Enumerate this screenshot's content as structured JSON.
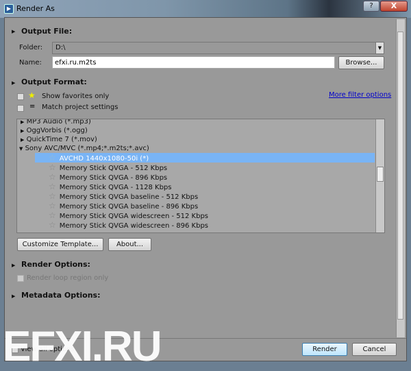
{
  "window": {
    "title": "Render As",
    "help": "?",
    "close": "X"
  },
  "output_file": {
    "header": "Output File:",
    "folder_label": "Folder:",
    "folder_value": "D:\\",
    "name_label": "Name:",
    "name_value": "efxi.ru.m2ts",
    "browse": "Browse..."
  },
  "output_format": {
    "header": "Output Format:",
    "show_favorites": "Show favorites only",
    "match_project": "Match project settings",
    "more_filter": "More filter options",
    "formats": [
      {
        "label": "MP3 Audio (*.mp3)",
        "expanded": false
      },
      {
        "label": "OggVorbis (*.ogg)",
        "expanded": false
      },
      {
        "label": "QuickTime 7 (*.mov)",
        "expanded": false
      },
      {
        "label": "Sony AVC/MVC (*.mp4;*.m2ts;*.avc)",
        "expanded": true
      }
    ],
    "templates": [
      {
        "label": "AVCHD 1440x1080-50i (*)",
        "selected": true
      },
      {
        "label": "Memory Stick QVGA - 512 Kbps"
      },
      {
        "label": "Memory Stick QVGA - 896 Kbps"
      },
      {
        "label": "Memory Stick QVGA - 1128 Kbps"
      },
      {
        "label": "Memory Stick QVGA baseline - 512 Kbps"
      },
      {
        "label": "Memory Stick QVGA baseline - 896 Kbps"
      },
      {
        "label": "Memory Stick QVGA widescreen - 512 Kbps"
      },
      {
        "label": "Memory Stick QVGA widescreen - 896 Kbps"
      }
    ],
    "customize": "Customize Template...",
    "about": "About..."
  },
  "render_options": {
    "header": "Render Options:",
    "loop_region": "Render loop region only"
  },
  "metadata_options": {
    "header": "Metadata Options:"
  },
  "footer": {
    "view_all": "View all options",
    "render": "Render",
    "cancel": "Cancel"
  },
  "watermark": "EFXI.RU",
  "colors": {
    "selection": "#79b4f5",
    "link": "#0000cc",
    "background": "#999999"
  }
}
